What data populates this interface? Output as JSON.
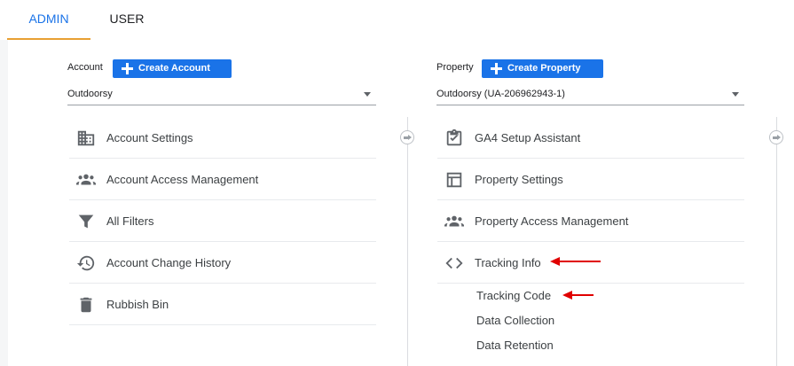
{
  "tabs": {
    "admin": "ADMIN",
    "user": "USER"
  },
  "account": {
    "label": "Account",
    "create_button": "Create Account",
    "selected": "Outdoorsy",
    "items": [
      {
        "label": "Account Settings",
        "icon": "building-icon"
      },
      {
        "label": "Account Access Management",
        "icon": "people-icon"
      },
      {
        "label": "All Filters",
        "icon": "filter-icon"
      },
      {
        "label": "Account Change History",
        "icon": "history-icon"
      },
      {
        "label": "Rubbish Bin",
        "icon": "trash-icon"
      }
    ]
  },
  "property": {
    "label": "Property",
    "create_button": "Create Property",
    "selected": "Outdoorsy (UA-206962943-1)",
    "items": [
      {
        "label": "GA4 Setup Assistant",
        "icon": "clipboard-check-icon"
      },
      {
        "label": "Property Settings",
        "icon": "layout-icon"
      },
      {
        "label": "Property Access Management",
        "icon": "people-icon"
      },
      {
        "label": "Tracking Info",
        "icon": "code-icon"
      }
    ],
    "subitems": [
      "Tracking Code",
      "Data Collection",
      "Data Retention"
    ]
  },
  "colors": {
    "accent": "#1a73e8",
    "tab_underline": "#e8a033",
    "annotation_arrow": "#e00000",
    "icon": "#5f6368"
  }
}
